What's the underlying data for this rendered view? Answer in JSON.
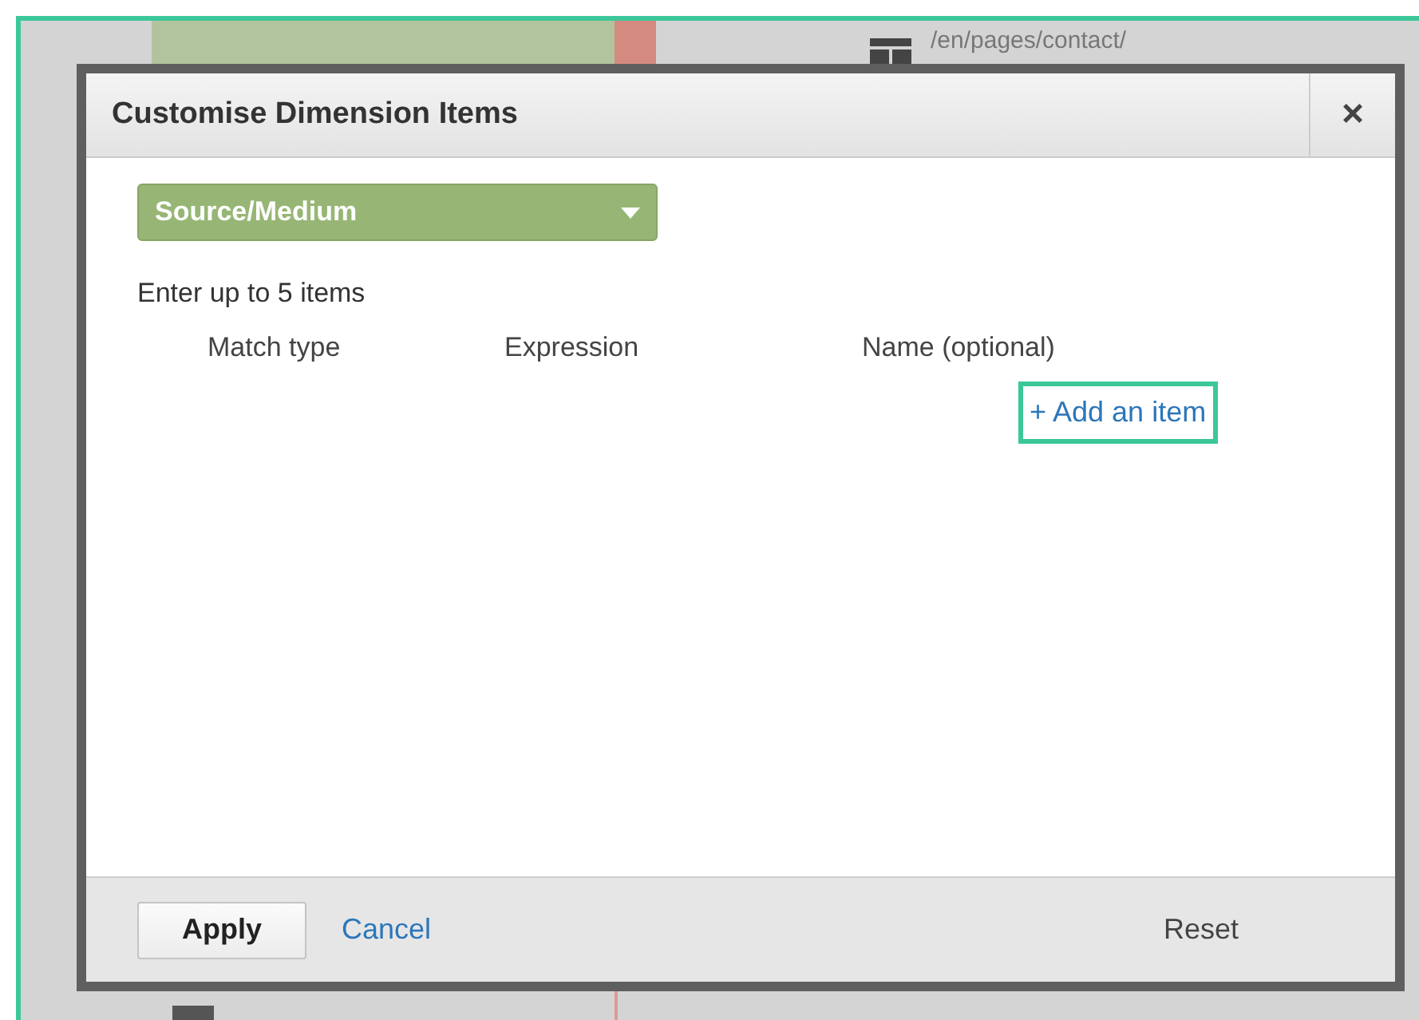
{
  "background": {
    "top_page": "/en/pages/contact/"
  },
  "dialog": {
    "title": "Customise Dimension Items",
    "close": "×",
    "dimension": {
      "value": "Source/Medium"
    },
    "hint": "Enter up to 5 items",
    "columns": [
      "Match type",
      "Expression",
      "Name (optional)"
    ],
    "add_item": {
      "label": "+ Add an item",
      "highlighted": true
    },
    "footer": {
      "apply": "Apply",
      "cancel": "Cancel",
      "reset": "Reset"
    }
  }
}
